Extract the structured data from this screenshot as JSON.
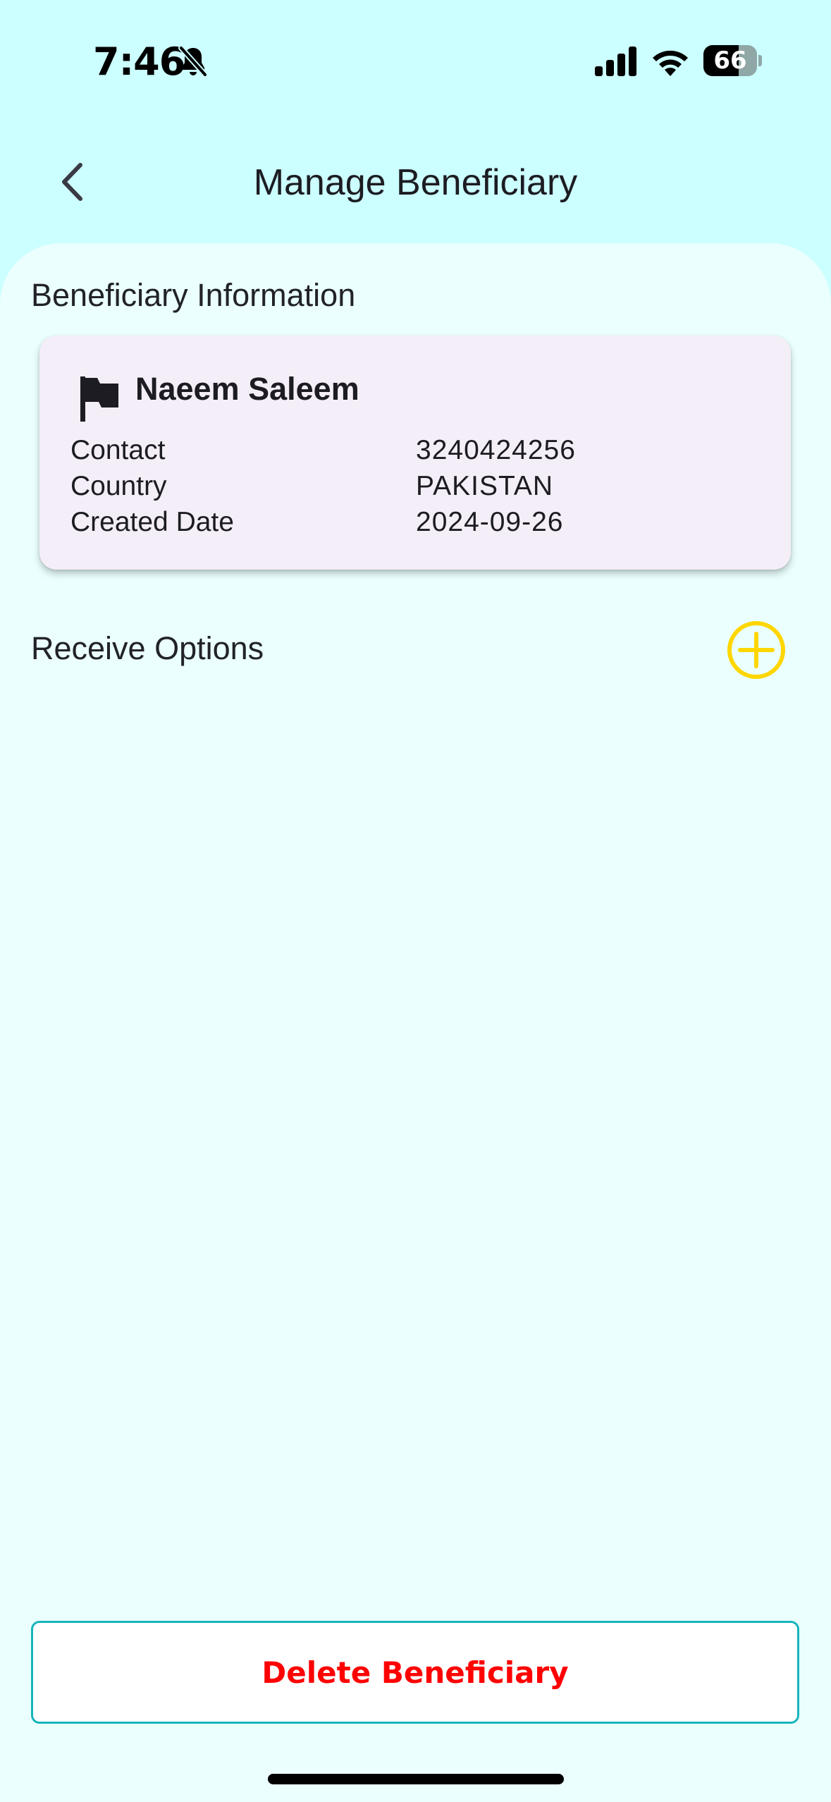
{
  "status_bar": {
    "time": "7:46",
    "battery_level": "66",
    "battery_fraction": 0.66,
    "icons": [
      "bell-slash-icon",
      "cellular-signal-icon",
      "wifi-icon",
      "battery-icon"
    ]
  },
  "header": {
    "title": "Manage Beneficiary",
    "back_icon": "chevron-left-icon"
  },
  "beneficiary_information": {
    "heading": "Beneficiary Information",
    "name": "Naeem Saleem",
    "flag_icon": "flag-icon",
    "details": [
      {
        "label": "Contact",
        "value": "3240424256"
      },
      {
        "label": "Country",
        "value": "PAKISTAN"
      },
      {
        "label": "Created Date",
        "value": "2024-09-26"
      }
    ]
  },
  "receive_options": {
    "heading": "Receive Options",
    "add_icon": "plus-circle-icon"
  },
  "actions": {
    "delete_label": "Delete Beneficiary"
  },
  "colors": {
    "header_background": "#ccffff",
    "panel_background": "#eafffe",
    "card_background": "#f4eef8",
    "accent_yellow": "#ffd600",
    "delete_text": "#ff0000",
    "delete_border": "#17b4bd"
  }
}
